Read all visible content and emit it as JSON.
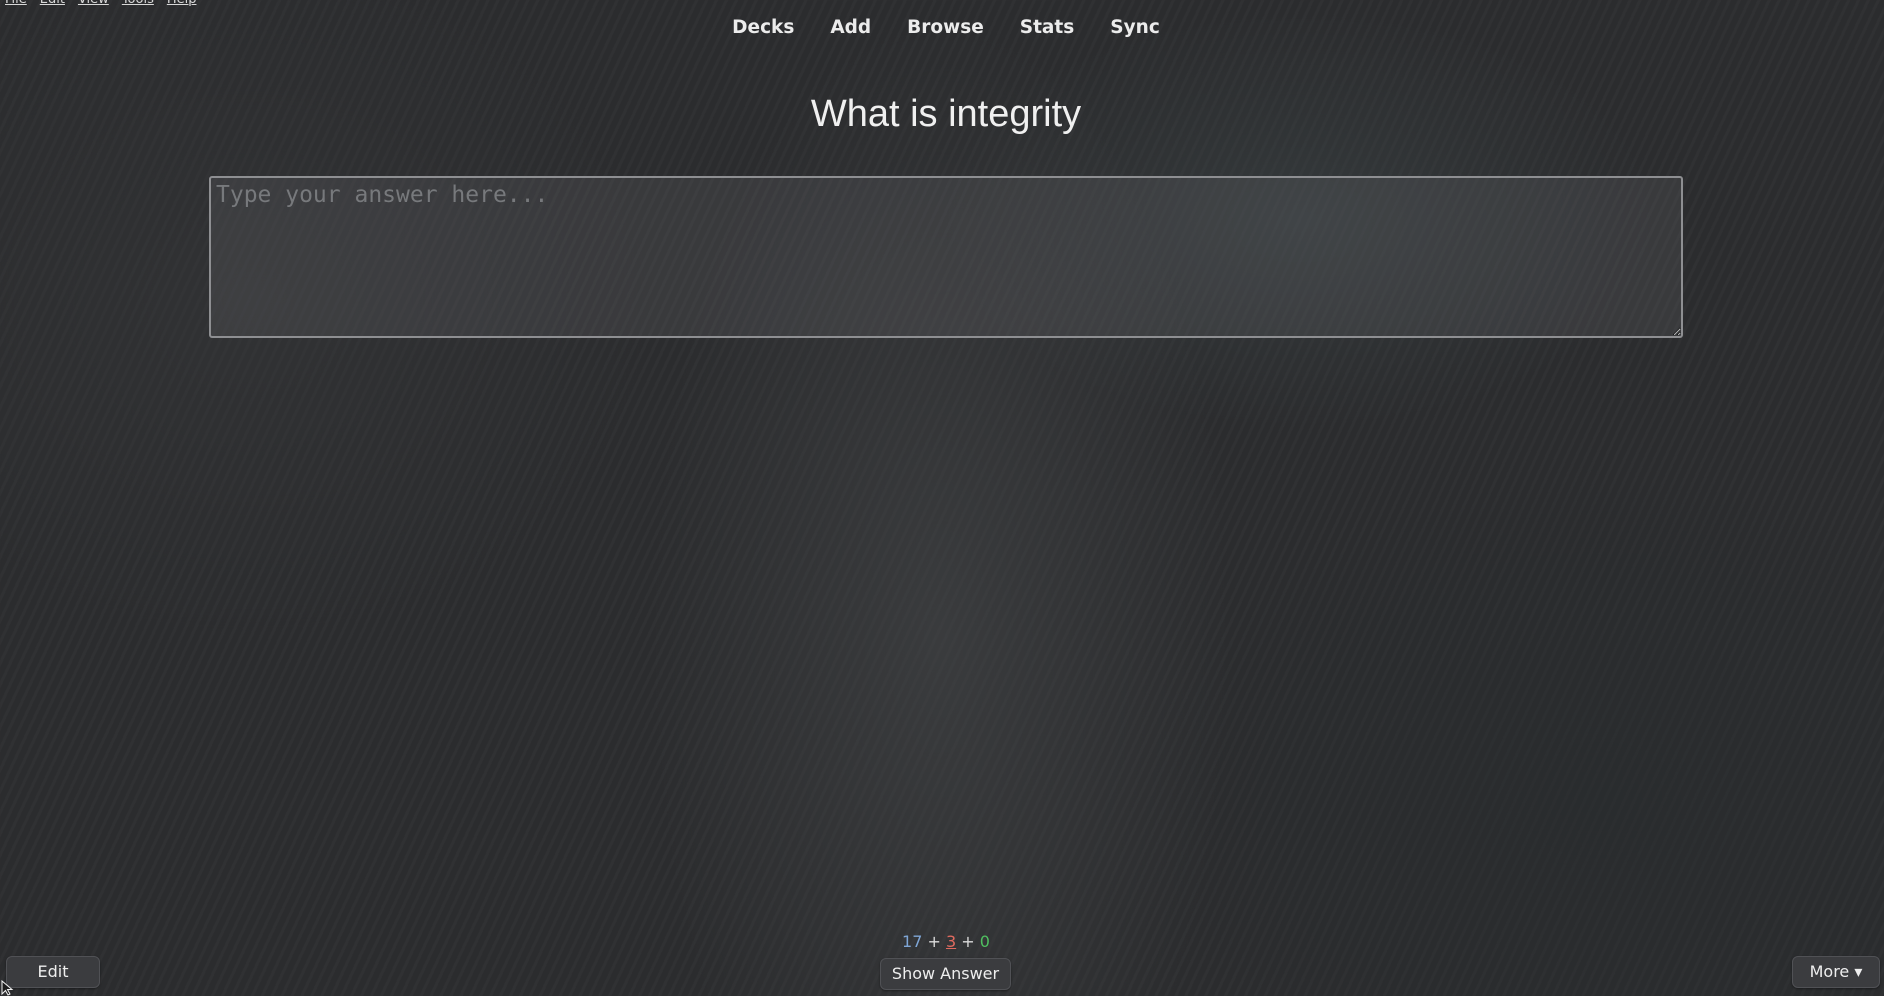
{
  "menubar": {
    "items": [
      "File",
      "Edit",
      "View",
      "Tools",
      "Help"
    ]
  },
  "nav": {
    "items": [
      "Decks",
      "Add",
      "Browse",
      "Stats",
      "Sync"
    ]
  },
  "card": {
    "question": "What is integrity",
    "answer_placeholder": "Type your answer here...",
    "answer_value": ""
  },
  "counts": {
    "new": "17",
    "learning": "3",
    "review": "0",
    "separator": "+"
  },
  "bottom_bar": {
    "edit_label": "Edit",
    "show_answer_label": "Show Answer",
    "more_label": "More ▾"
  },
  "colors": {
    "background": "#2c2d2f",
    "new_count": "#7fa6d6",
    "learning_count": "#e06a5f",
    "review_count": "#4fbf5f"
  }
}
